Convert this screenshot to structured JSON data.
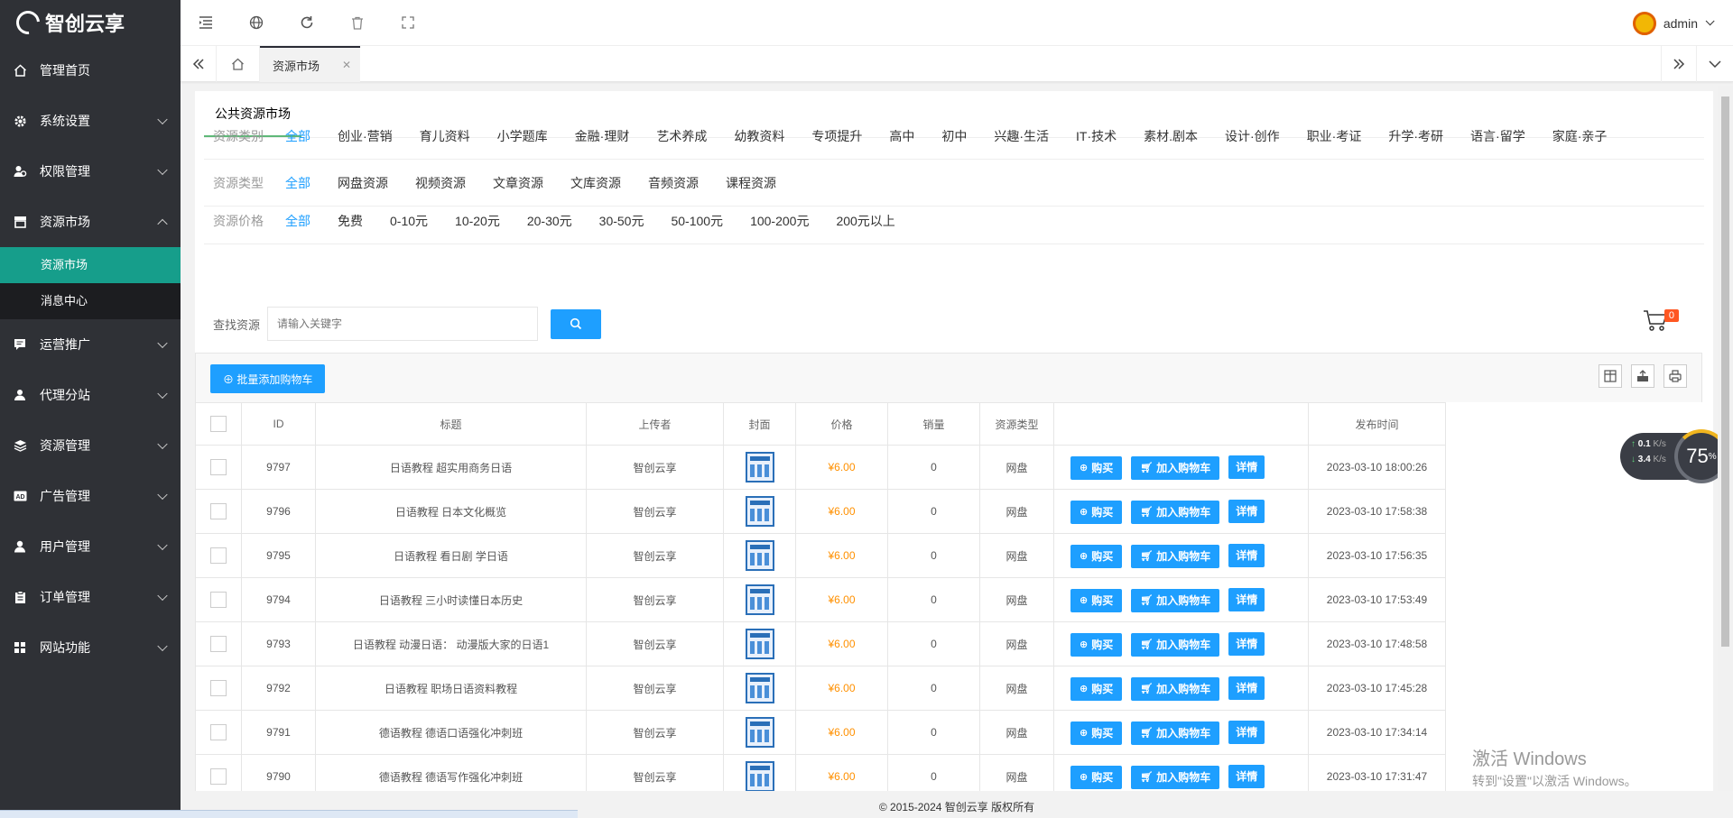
{
  "brand": {
    "name": "智创云享"
  },
  "sidebar": {
    "items": [
      {
        "label": "管理首页",
        "icon": "home-icon",
        "has_children": false
      },
      {
        "label": "系统设置",
        "icon": "gear-icon",
        "has_children": true
      },
      {
        "label": "权限管理",
        "icon": "user-group-icon",
        "has_children": true
      },
      {
        "label": "资源市场",
        "icon": "store-icon",
        "has_children": true,
        "expanded": true
      },
      {
        "label": "运营推广",
        "icon": "message-icon",
        "has_children": true
      },
      {
        "label": "代理分站",
        "icon": "agent-icon",
        "has_children": true
      },
      {
        "label": "资源管理",
        "icon": "layers-icon",
        "has_children": true
      },
      {
        "label": "广告管理",
        "icon": "ad-icon",
        "has_children": true
      },
      {
        "label": "用户管理",
        "icon": "user-icon",
        "has_children": true
      },
      {
        "label": "订单管理",
        "icon": "clipboard-icon",
        "has_children": true
      },
      {
        "label": "网站功能",
        "icon": "grid-icon",
        "has_children": true
      }
    ],
    "sub_items": [
      {
        "label": "资源市场",
        "active": true
      },
      {
        "label": "消息中心",
        "active": false
      }
    ]
  },
  "header": {
    "username": "admin"
  },
  "tabs": {
    "active_label": "资源市场"
  },
  "card": {
    "title": "公共资源市场",
    "filters": [
      {
        "label": "资源类别",
        "options": [
          "全部",
          "创业·营销",
          "育儿资料",
          "小学题库",
          "金融·理财",
          "艺术养成",
          "幼教资料",
          "专项提升",
          "高中",
          "初中",
          "兴趣·生活",
          "IT·技术",
          "素材.剧本",
          "设计·创作",
          "职业·考证",
          "升学·考研",
          "语言·留学",
          "家庭·亲子"
        ],
        "selected": 0
      },
      {
        "label": "资源类型",
        "options": [
          "全部",
          "网盘资源",
          "视频资源",
          "文章资源",
          "文库资源",
          "音频资源",
          "课程资源"
        ],
        "selected": 0
      },
      {
        "label": "资源价格",
        "options": [
          "全部",
          "免费",
          "0-10元",
          "10-20元",
          "20-30元",
          "30-50元",
          "50-100元",
          "100-200元",
          "200元以上"
        ],
        "selected": 0
      }
    ],
    "search": {
      "label": "查找资源",
      "placeholder": "请输入关键字"
    },
    "cart_count": "0",
    "batch_add_label": "批量添加购物车",
    "columns": [
      "ID",
      "标题",
      "上传者",
      "封面",
      "价格",
      "销量",
      "资源类型",
      "",
      "发布时间"
    ],
    "actions": {
      "buy": "购买",
      "add_cart": "加入购物车",
      "detail": "详情"
    },
    "rows": [
      {
        "id": "9797",
        "title": "日语教程 超实用商务日语",
        "uploader": "智创云享",
        "price": "¥6.00",
        "sales": "0",
        "type": "网盘",
        "time": "2023-03-10 18:00:26"
      },
      {
        "id": "9796",
        "title": "日语教程 日本文化概览",
        "uploader": "智创云享",
        "price": "¥6.00",
        "sales": "0",
        "type": "网盘",
        "time": "2023-03-10 17:58:38"
      },
      {
        "id": "9795",
        "title": "日语教程 看日剧 学日语",
        "uploader": "智创云享",
        "price": "¥6.00",
        "sales": "0",
        "type": "网盘",
        "time": "2023-03-10 17:56:35"
      },
      {
        "id": "9794",
        "title": "日语教程 三小时读懂日本历史",
        "uploader": "智创云享",
        "price": "¥6.00",
        "sales": "0",
        "type": "网盘",
        "time": "2023-03-10 17:53:49"
      },
      {
        "id": "9793",
        "title": "日语教程 动漫日语： 动漫版大家的日语1",
        "uploader": "智创云享",
        "price": "¥6.00",
        "sales": "0",
        "type": "网盘",
        "time": "2023-03-10 17:48:58"
      },
      {
        "id": "9792",
        "title": "日语教程 职场日语资料教程",
        "uploader": "智创云享",
        "price": "¥6.00",
        "sales": "0",
        "type": "网盘",
        "time": "2023-03-10 17:45:28"
      },
      {
        "id": "9791",
        "title": "德语教程 德语口语强化冲刺班",
        "uploader": "智创云享",
        "price": "¥6.00",
        "sales": "0",
        "type": "网盘",
        "time": "2023-03-10 17:34:14"
      },
      {
        "id": "9790",
        "title": "德语教程 德语写作强化冲刺班",
        "uploader": "智创云享",
        "price": "¥6.00",
        "sales": "0",
        "type": "网盘",
        "time": "2023-03-10 17:31:47"
      }
    ]
  },
  "speed_widget": {
    "up": "0.1",
    "down": "3.4",
    "unit": "K/s",
    "percent": "75",
    "percent_sign": "%"
  },
  "watermark": {
    "line1": "激活 Windows",
    "line2": "转到\"设置\"以激活 Windows。"
  },
  "footer": {
    "copyright": "© 2015-2024 智创云享 版权所有"
  }
}
